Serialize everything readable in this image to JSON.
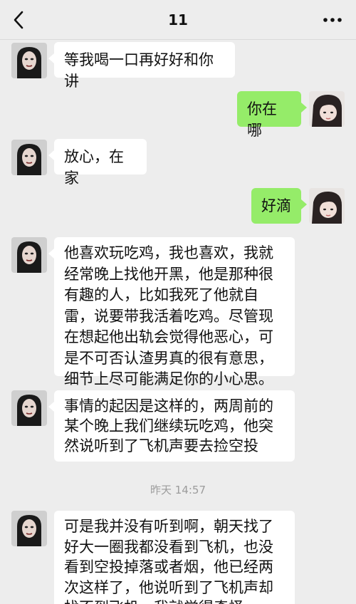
{
  "header": {
    "title": "11",
    "back_icon": "chevron-left-icon",
    "more_icon": "ellipsis-icon"
  },
  "messages": [
    {
      "side": "left",
      "text": "等我喝一口再好好和你讲"
    },
    {
      "side": "right",
      "text": "你在哪"
    },
    {
      "side": "left",
      "text": "放心，在家"
    },
    {
      "side": "right",
      "text": "好滴"
    },
    {
      "side": "left",
      "text": "他喜欢玩吃鸡，我也喜欢，我就经常晚上找他开黑，他是那种很有趣的人，比如我死了他就自雷，说要带我活着吃鸡。尽管现在想起他出轨会觉得他恶心，可是不可否认渣男真的很有意思，细节上尽可能满足你的小心思。"
    },
    {
      "side": "left",
      "text": "事情的起因是这样的，两周前的某个晚上我们继续玩吃鸡，他突然说听到了飞机声要去捡空投"
    },
    {
      "side": "left",
      "text": "可是我并没有听到啊，朝天找了好大一圈我都没看到飞机，也没看到空投掉落或者烟，他已经两次这样了，他说听到了飞机声却找不到飞机，我就觉得奇怪"
    }
  ],
  "timestamp": "昨天 14:57",
  "colors": {
    "background": "#ededed",
    "incoming_bubble": "#ffffff",
    "outgoing_bubble": "#95ec69"
  }
}
